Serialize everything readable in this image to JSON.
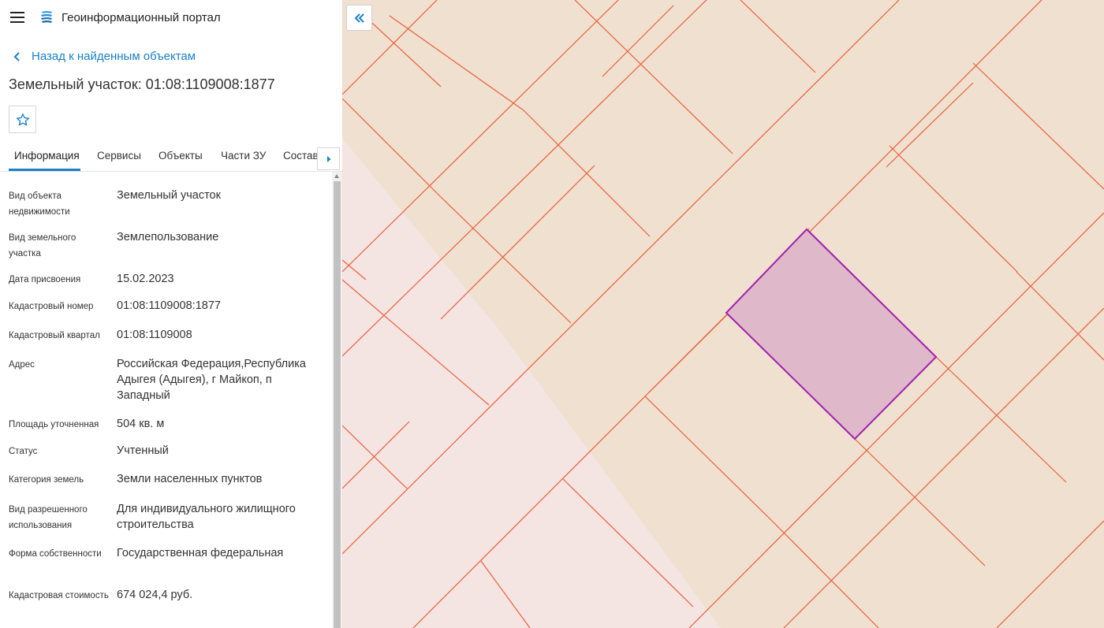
{
  "header": {
    "menu_icon": "hamburger-icon",
    "logo_icon": "portal-logo-icon",
    "title": "Геоинформационный портал"
  },
  "back": {
    "icon": "chevron-left-icon",
    "label": "Назад к найденным объектам"
  },
  "object": {
    "title": "Земельный участок: 01:08:1109008:1877",
    "favorite_icon": "star-icon"
  },
  "tabs": [
    {
      "label": "Информация",
      "active": true
    },
    {
      "label": "Сервисы",
      "active": false
    },
    {
      "label": "Объекты",
      "active": false
    },
    {
      "label": "Части ЗУ",
      "active": false
    },
    {
      "label": "Состав",
      "active": false
    }
  ],
  "tabs_next_icon": "caret-right-icon",
  "properties": [
    {
      "label": "Вид объекта недвижимости",
      "value": "Земельный участок"
    },
    {
      "label": "Вид земельного участка",
      "value": "Землепользование"
    },
    {
      "label": "Дата присвоения",
      "value": "15.02.2023"
    },
    {
      "label": "Кадастровый номер",
      "value": "01:08:1109008:1877"
    },
    {
      "label": "Кадастровый квартал",
      "value": "01:08:1109008"
    },
    {
      "label": "Адрес",
      "value": "Российская Федерация,Республика Адыгея (Адыгея), г Майкоп, п Западный"
    },
    {
      "label": "Площадь уточненная",
      "value": "504 кв. м"
    },
    {
      "label": "Статус",
      "value": "Учтенный"
    },
    {
      "label": "Категория земель",
      "value": "Земли населенных пунктов"
    },
    {
      "label": "Вид разрешенного использования",
      "value": "Для индивидуального жилищного строительства"
    },
    {
      "label": "Форма собственности",
      "value": "Государственная федеральная"
    },
    {
      "label": "Кадастровая стоимость",
      "value": "674 024,4 руб."
    }
  ],
  "map": {
    "collapse_icon": "double-chevron-left-icon",
    "colors": {
      "background": "#f0e0d0",
      "pink_zone": "#f4e4e2",
      "parcel_lines": "#e8603a",
      "selected_fill": "#dfb8ca",
      "selected_stroke": "#a020b0",
      "accent": "#1a80c8"
    }
  }
}
